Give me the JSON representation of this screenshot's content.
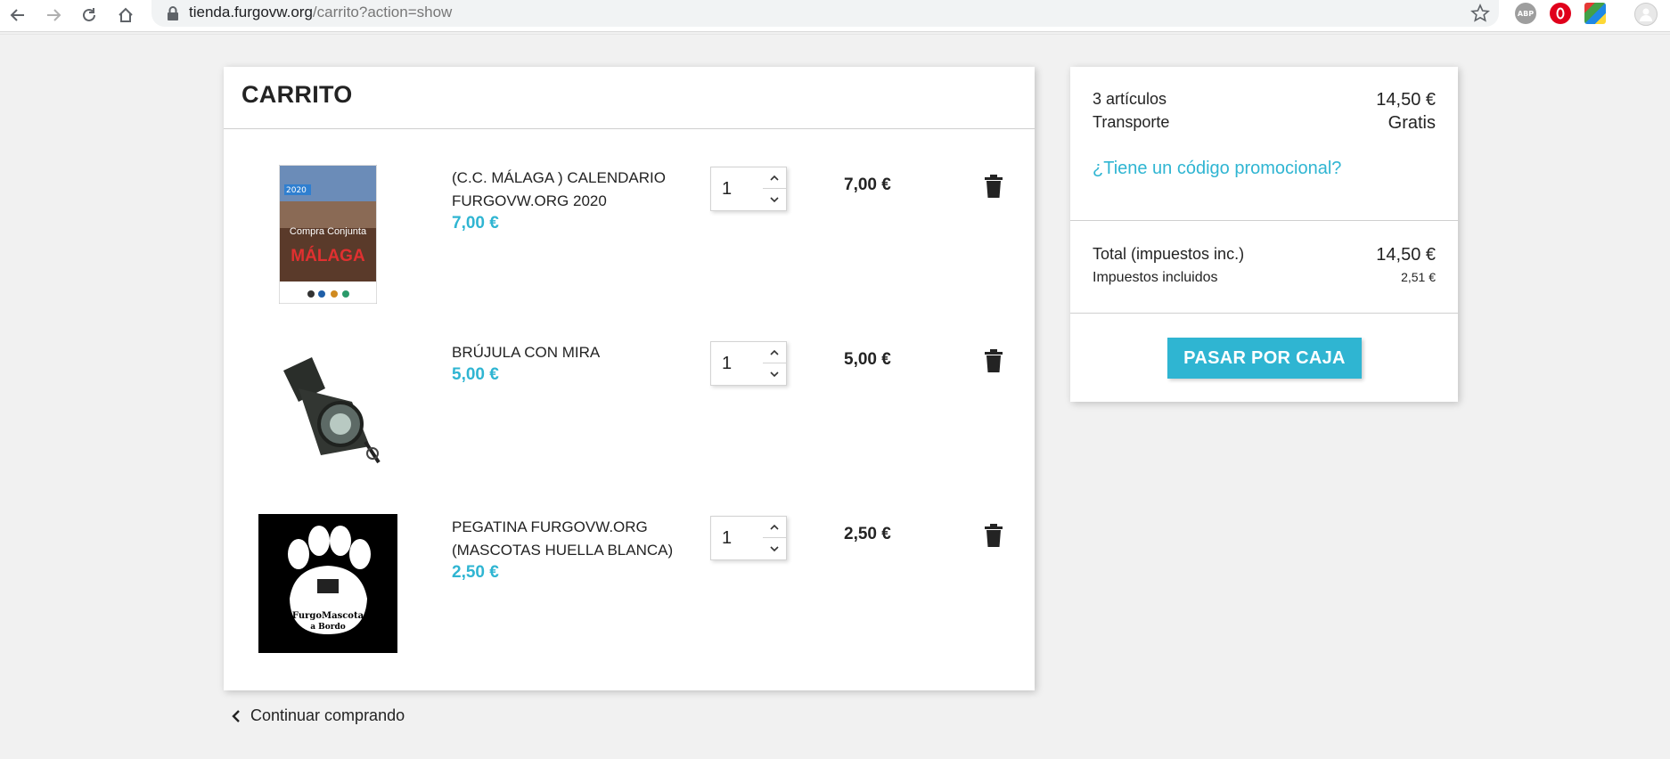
{
  "browser": {
    "url_domain": "tienda.furgovw.org",
    "url_path": "/carrito?action=show",
    "ext_abp": "ABP"
  },
  "cart": {
    "title": "CARRITO",
    "items": [
      {
        "name": "(C.C. MÁLAGA ) CALENDARIO FURGOVW.ORG 2020",
        "price": "7,00 €",
        "qty": "1",
        "total": "7,00 €",
        "thumb_text_top": "2020",
        "thumb_text_mid": "Compra Conjunta",
        "thumb_text_big": "MÁLAGA"
      },
      {
        "name": "BRÚJULA CON MIRA",
        "price": "5,00 €",
        "qty": "1",
        "total": "5,00 €"
      },
      {
        "name": "PEGATINA FURGOVW.ORG (MASCOTAS HUELLA BLANCA)",
        "price": "2,50 €",
        "qty": "1",
        "total": "2,50 €",
        "thumb_text_1": "FurgoMascota",
        "thumb_text_2": "a Bordo"
      }
    ],
    "continue_label": "Continuar comprando"
  },
  "summary": {
    "items_label": "3 artículos",
    "items_value": "14,50 €",
    "shipping_label": "Transporte",
    "shipping_value": "Gratis",
    "promo_label": "¿Tiene un código promocional?",
    "total_label": "Total (impuestos inc.)",
    "total_value": "14,50 €",
    "tax_label": "Impuestos incluidos",
    "tax_value": "2,51 €",
    "checkout_label": "PASAR POR CAJA"
  },
  "colors": {
    "accent": "#2fb5d2",
    "text": "#232323",
    "background": "#f1f1f1"
  }
}
